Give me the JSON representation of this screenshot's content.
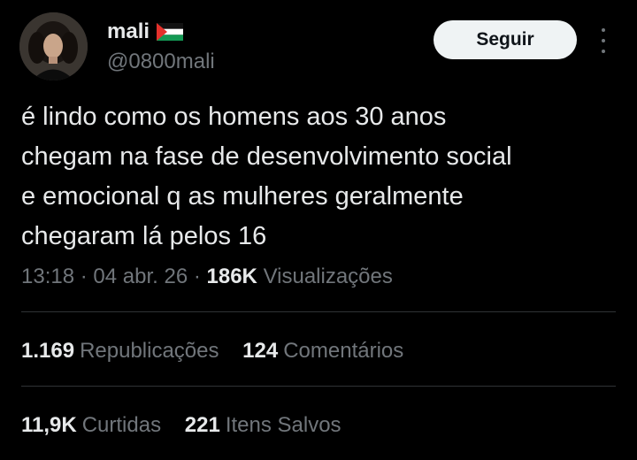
{
  "author": {
    "display_name": "mali",
    "handle": "@0800mali",
    "flag_icon": "palestine-flag-icon"
  },
  "follow_button": {
    "label": "Seguir"
  },
  "more_button": {
    "icon": "more-vertical-icon"
  },
  "tweet": {
    "lines": [
      "é lindo como os homens aos 30 anos",
      "chegam na fase de desenvolvimento social",
      "e emocional q as mulheres geralmente",
      "chegaram lá pelos 16"
    ]
  },
  "meta": {
    "time": "13:18",
    "separator": "·",
    "date": "04 abr. 26",
    "views_count": "186K",
    "views_label": "Visualizações"
  },
  "stats": {
    "reposts": {
      "count": "1.169",
      "label": "Republicações"
    },
    "comments": {
      "count": "124",
      "label": "Comentários"
    },
    "likes": {
      "count": "11,9K",
      "label": "Curtidas"
    },
    "bookmarks": {
      "count": "221",
      "label": "Itens Salvos"
    }
  },
  "colors": {
    "background": "#000000",
    "primary_text": "#e7e9ea",
    "secondary_text": "#71767b",
    "divider": "#2f3336",
    "button_bg": "#eff3f4",
    "button_text": "#0f1419"
  }
}
